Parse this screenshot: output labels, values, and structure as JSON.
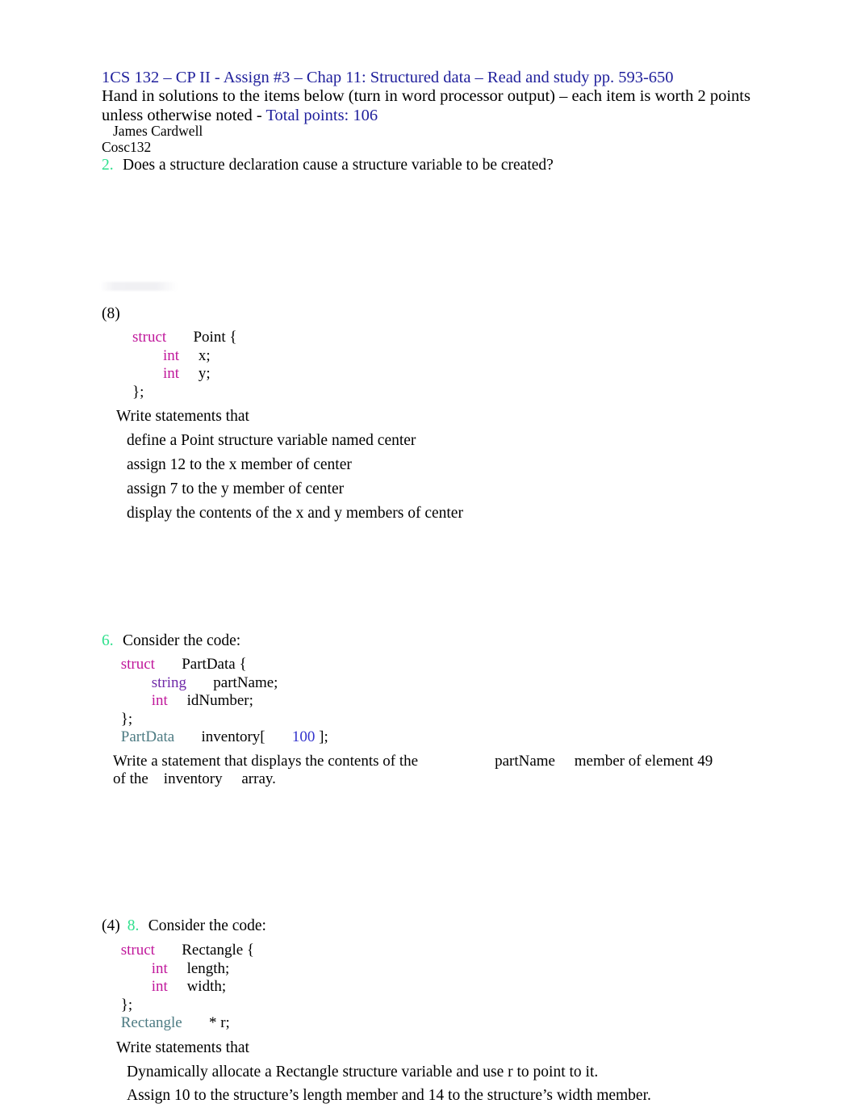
{
  "document": {
    "header": {
      "title": "1CS 132 – CP II - Assign #3 – Chap 11:  Structured data – Read and study pp. 593-650",
      "instructions_part1": "Hand in solutions to the items below (turn in word processor output) – each item is worth 2 points unless otherwise noted -",
      "instructions_accent": "Total points:   106",
      "student_name": "James Cardwell",
      "course": "Cosc132"
    },
    "colors": {
      "title_blue": "#20209c",
      "item_number_green": "#2fe08d",
      "keyword_magenta": "#c0179b",
      "keyword_violet": "#6f28a8",
      "type_teal": "#4d7b83",
      "number_literal_blue": "#3333cc",
      "body_black": "#000000",
      "page_background": "#ffffff"
    },
    "items": [
      {
        "number": "2.",
        "points": "",
        "prompt": "Does a structure declaration cause a structure variable to be created?"
      },
      {
        "number": "",
        "points": "(8)",
        "prompt": "",
        "code_lines": [
          [
            {
              "t": "        ",
              "c": "plain"
            },
            {
              "t": "struct",
              "c": "kw-struct"
            },
            {
              "t": "       Point {",
              "c": "plain"
            }
          ],
          [
            {
              "t": "                ",
              "c": "plain"
            },
            {
              "t": "int",
              "c": "kw-int"
            },
            {
              "t": "     x;",
              "c": "plain"
            }
          ],
          [
            {
              "t": "                ",
              "c": "plain"
            },
            {
              "t": "int",
              "c": "kw-int"
            },
            {
              "t": "     y;",
              "c": "plain"
            }
          ],
          [
            {
              "t": "        };",
              "c": "plain"
            }
          ]
        ],
        "lead": "Write statements that",
        "sub_items": [
          "define a Point structure variable named center",
          "assign 12 to the x member of center",
          "assign 7 to the y member of center",
          "display the contents of the x and y members of center"
        ]
      },
      {
        "number": "6.",
        "points": "",
        "prompt": "Consider the code:",
        "code_lines": [
          [
            {
              "t": "     ",
              "c": "plain"
            },
            {
              "t": "struct",
              "c": "kw-struct"
            },
            {
              "t": "       PartData {",
              "c": "plain"
            }
          ],
          [
            {
              "t": "             ",
              "c": "plain"
            },
            {
              "t": "string",
              "c": "kw-string"
            },
            {
              "t": "       partName;",
              "c": "plain"
            }
          ],
          [
            {
              "t": "             ",
              "c": "plain"
            },
            {
              "t": "int",
              "c": "kw-int"
            },
            {
              "t": "     idNumber;",
              "c": "plain"
            }
          ],
          [
            {
              "t": "     };",
              "c": "plain"
            }
          ],
          [
            {
              "t": "     ",
              "c": "plain"
            },
            {
              "t": "PartData",
              "c": "type-name"
            },
            {
              "t": "       inventory[       ",
              "c": "plain"
            },
            {
              "t": "100",
              "c": "num-lit"
            },
            {
              "t": " ];",
              "c": "plain"
            }
          ]
        ],
        "statement_line1": "Write a statement that displays the contents of the                    partName     member of element 49",
        "statement_line2": "of the    inventory     array."
      },
      {
        "number": "8.",
        "points": "(4)",
        "prompt": "Consider the code:",
        "code_lines": [
          [
            {
              "t": "     ",
              "c": "plain"
            },
            {
              "t": "struct",
              "c": "kw-struct"
            },
            {
              "t": "       Rectangle {",
              "c": "plain"
            }
          ],
          [
            {
              "t": "             ",
              "c": "plain"
            },
            {
              "t": "int",
              "c": "kw-int"
            },
            {
              "t": "     length;",
              "c": "plain"
            }
          ],
          [
            {
              "t": "             ",
              "c": "plain"
            },
            {
              "t": "int",
              "c": "kw-int"
            },
            {
              "t": "     width;",
              "c": "plain"
            }
          ],
          [
            {
              "t": "     };",
              "c": "plain"
            }
          ],
          [
            {
              "t": "     ",
              "c": "plain"
            },
            {
              "t": "Rectangle",
              "c": "type-name"
            },
            {
              "t": "       * r;",
              "c": "plain"
            }
          ]
        ],
        "lead": "Write statements that",
        "sub_items": [
          "Dynamically allocate a Rectangle structure variable and use r to point to it.",
          "Assign 10 to the structure’s length member and 14 to the structure’s width member."
        ]
      }
    ]
  }
}
